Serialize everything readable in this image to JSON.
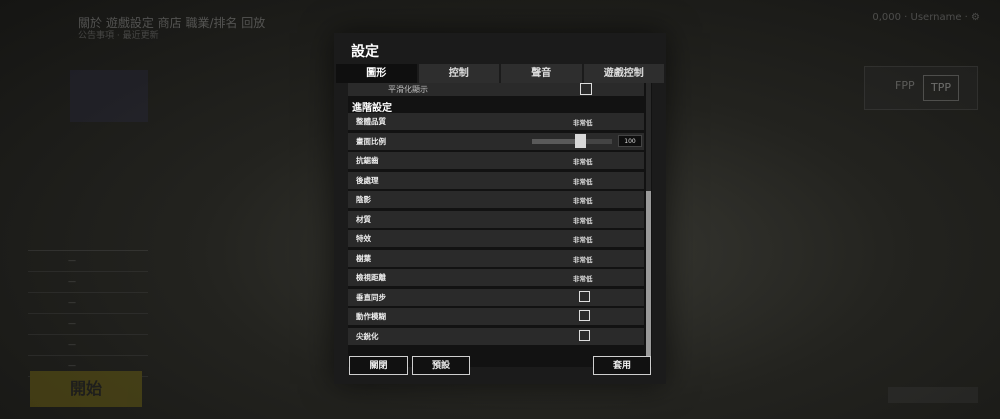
{
  "background": {
    "title": "關於 遊戲設定 商店 職業/排名 回放",
    "subtitle": "公告事項 · 最近更新",
    "top_right": "0,000 · Username · ⚙",
    "fpp_label": "FPP",
    "fpp_value": "TPP",
    "left_list": [
      "—",
      "—",
      "—",
      "—",
      "—",
      "—"
    ],
    "start_label": "開始"
  },
  "dialog": {
    "title": "設定",
    "tabs": [
      {
        "label": "圖形",
        "active": true
      },
      {
        "label": "控制",
        "active": false
      },
      {
        "label": "聲音",
        "active": false
      },
      {
        "label": "遊戲控制",
        "active": false
      }
    ],
    "cut_row_label": "平滑化顯示",
    "section_title": "進階設定",
    "rows": [
      {
        "label": "整體品質",
        "type": "value",
        "value": "非常低"
      },
      {
        "label": "畫面比例",
        "type": "slider",
        "value": "100",
        "fraction": 0.6
      },
      {
        "label": "抗鋸齒",
        "type": "value",
        "value": "非常低"
      },
      {
        "label": "後處理",
        "type": "value",
        "value": "非常低"
      },
      {
        "label": "陰影",
        "type": "value",
        "value": "非常低"
      },
      {
        "label": "材質",
        "type": "value",
        "value": "非常低"
      },
      {
        "label": "特效",
        "type": "value",
        "value": "非常低"
      },
      {
        "label": "樹葉",
        "type": "value",
        "value": "非常低"
      },
      {
        "label": "檢視距離",
        "type": "value",
        "value": "非常低"
      },
      {
        "label": "垂直同步",
        "type": "checkbox",
        "checked": false
      },
      {
        "label": "動作模糊",
        "type": "checkbox",
        "checked": false
      },
      {
        "label": "尖銳化",
        "type": "checkbox",
        "checked": false
      }
    ],
    "scroll_fraction": 0.62,
    "buttons": {
      "close": "關閉",
      "default": "預設",
      "apply": "套用"
    }
  },
  "colors": {
    "dialog_bg": "#1b1b1b",
    "row_bg": "#2a2a2a",
    "accent": "#ffffff"
  }
}
